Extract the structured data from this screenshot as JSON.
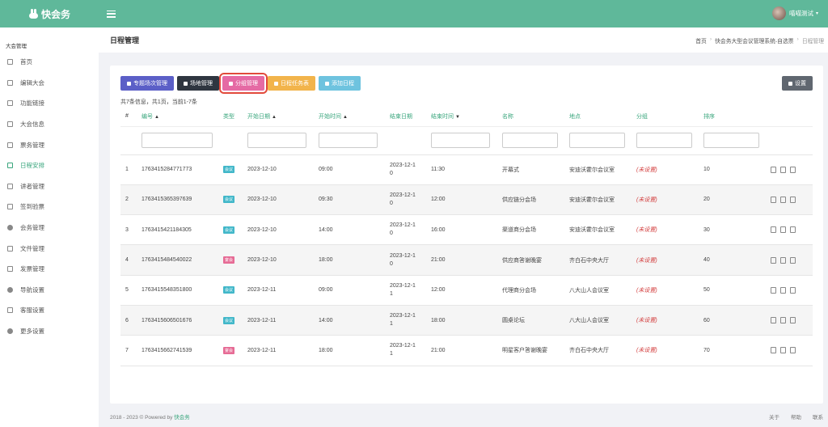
{
  "app": {
    "name": "快会务"
  },
  "user": {
    "name": "喵喵测试"
  },
  "sidebar": {
    "group": "大会管理",
    "items": [
      {
        "label": "首页",
        "icon": "grid-icon"
      },
      {
        "label": "编辑大会",
        "icon": "edit-icon"
      },
      {
        "label": "功能链接",
        "icon": "table-icon"
      },
      {
        "label": "大会信息",
        "icon": "list-icon"
      },
      {
        "label": "票务管理",
        "icon": "ticket-icon"
      },
      {
        "label": "日程安排",
        "icon": "calendar-icon",
        "active": true
      },
      {
        "label": "讲者管理",
        "icon": "speaker-icon"
      },
      {
        "label": "签到验票",
        "icon": "scan-icon"
      },
      {
        "label": "会务管理",
        "icon": "gear-icon"
      },
      {
        "label": "文件管理",
        "icon": "cloud-icon"
      },
      {
        "label": "发票管理",
        "icon": "invoice-icon"
      },
      {
        "label": "导航设置",
        "icon": "pin-icon"
      },
      {
        "label": "客服设置",
        "icon": "headset-icon"
      },
      {
        "label": "更多设置",
        "icon": "more-icon"
      }
    ]
  },
  "page": {
    "title": "日程管理",
    "breadcrumbs": [
      "首页",
      "快会务大型会议管理系统-自选票",
      "日程管理"
    ]
  },
  "toolbar": {
    "buttons": [
      {
        "label": "专题场次管理",
        "color": "#5b5fc7"
      },
      {
        "label": "场地管理",
        "color": "#2f3640"
      },
      {
        "label": "分组管理",
        "color": "#e56aa4"
      },
      {
        "label": "日程任务表",
        "color": "#f2b44b"
      },
      {
        "label": "添加日程",
        "color": "#6ec3df"
      }
    ],
    "settings_label": "设置"
  },
  "summary": "共7条信息，共1页，当前1-7条",
  "table": {
    "headers": [
      "#",
      "编号",
      "类型",
      "开始日期",
      "开始时间",
      "结束日期",
      "结束时间",
      "名称",
      "地点",
      "分组",
      "排序"
    ],
    "rows": [
      {
        "idx": "1",
        "code": "1763415284771773",
        "type": "会议",
        "start_date": "2023-12-10",
        "start_time": "09:00",
        "end_date": "2023-12-10",
        "end_time": "11:30",
        "name": "开幕式",
        "place": "安迪沃霍尔会议室",
        "group": "(未设置)",
        "order": "10"
      },
      {
        "idx": "2",
        "code": "1763415365397639",
        "type": "会议",
        "start_date": "2023-12-10",
        "start_time": "09:30",
        "end_date": "2023-12-10",
        "end_time": "12:00",
        "name": "供应链分会场",
        "place": "安迪沃霍尔会议室",
        "group": "(未设置)",
        "order": "20"
      },
      {
        "idx": "3",
        "code": "1763415421184305",
        "type": "会议",
        "start_date": "2023-12-10",
        "start_time": "14:00",
        "end_date": "2023-12-10",
        "end_time": "16:00",
        "name": "渠道商分会场",
        "place": "安迪沃霍尔会议室",
        "group": "(未设置)",
        "order": "30"
      },
      {
        "idx": "4",
        "code": "1763415484540022",
        "type": "宴会",
        "start_date": "2023-12-10",
        "start_time": "18:00",
        "end_date": "2023-12-10",
        "end_time": "21:00",
        "name": "供应商答谢晚宴",
        "place": "齐白石中央大厅",
        "group": "(未设置)",
        "order": "40"
      },
      {
        "idx": "5",
        "code": "1763415548351800",
        "type": "会议",
        "start_date": "2023-12-11",
        "start_time": "09:00",
        "end_date": "2023-12-11",
        "end_time": "12:00",
        "name": "代理商分会场",
        "place": "八大山人会议室",
        "group": "(未设置)",
        "order": "50"
      },
      {
        "idx": "6",
        "code": "1763415606501676",
        "type": "会议",
        "start_date": "2023-12-11",
        "start_time": "14:00",
        "end_date": "2023-12-11",
        "end_time": "18:00",
        "name": "圆桌论坛",
        "place": "八大山人会议室",
        "group": "(未设置)",
        "order": "60"
      },
      {
        "idx": "7",
        "code": "1763415662741539",
        "type": "宴会",
        "start_date": "2023-12-11",
        "start_time": "18:00",
        "end_date": "2023-12-11",
        "end_time": "21:00",
        "name": "明星客户答谢晚宴",
        "place": "齐白石中央大厅",
        "group": "(未设置)",
        "order": "70"
      }
    ]
  },
  "footer": {
    "copyright": "2018 - 2023 © Powered by",
    "brand": "快会务",
    "links": [
      "关于",
      "帮助",
      "联系"
    ]
  },
  "colors": {
    "topbar": "#5fb89a",
    "accent": "#3aa67d",
    "unset": "#d23a3a"
  }
}
